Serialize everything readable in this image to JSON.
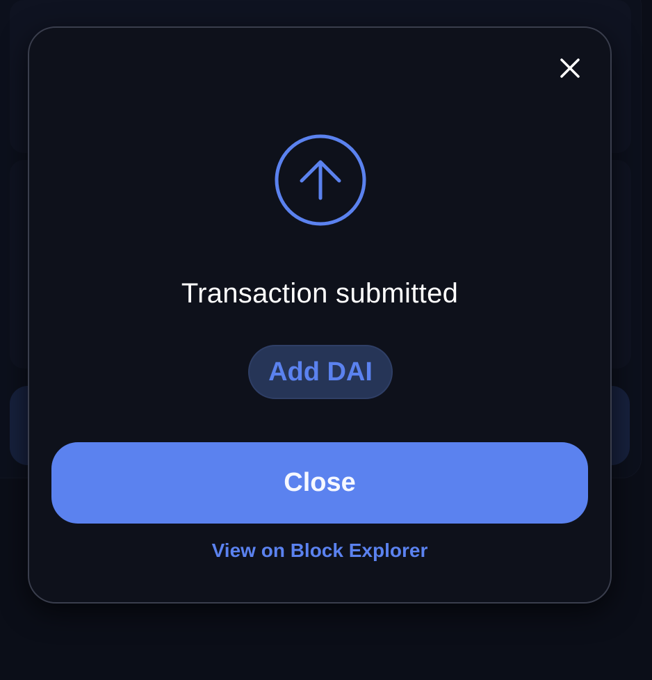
{
  "modal": {
    "title": "Transaction submitted",
    "add_token_label": "Add DAI",
    "close_button_label": "Close",
    "explorer_link_label": "View on Block Explorer",
    "status_icon": "arrow-up-circle-icon",
    "dismiss_icon": "close-icon"
  },
  "colors": {
    "accent": "#5b82ef",
    "modal_background": "#0e111b",
    "page_background": "#0d111c",
    "token_button_background": "#263557",
    "text_primary": "#ffffff"
  }
}
